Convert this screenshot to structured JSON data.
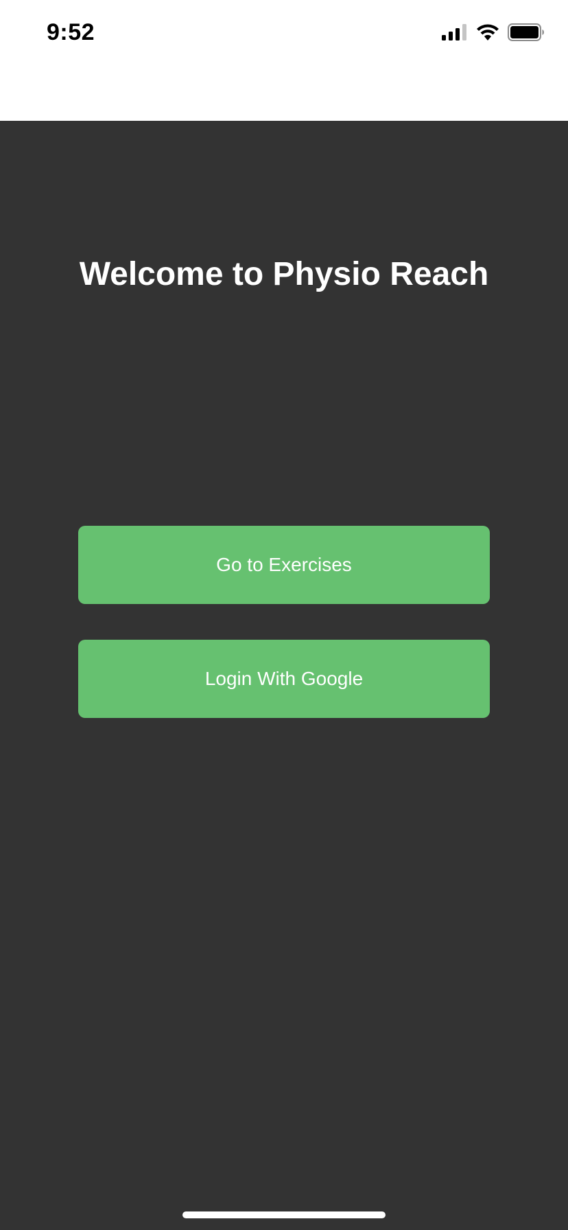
{
  "status_bar": {
    "time": "9:52",
    "icons": [
      "cellular-signal-icon",
      "wifi-icon",
      "battery-icon"
    ],
    "background": "#ffffff"
  },
  "main": {
    "title": "Welcome to Physio Reach",
    "background": "#333333",
    "buttons": [
      {
        "label": "Go to Exercises",
        "color": "#66c170"
      },
      {
        "label": "Login With Google",
        "color": "#66c170"
      }
    ]
  }
}
